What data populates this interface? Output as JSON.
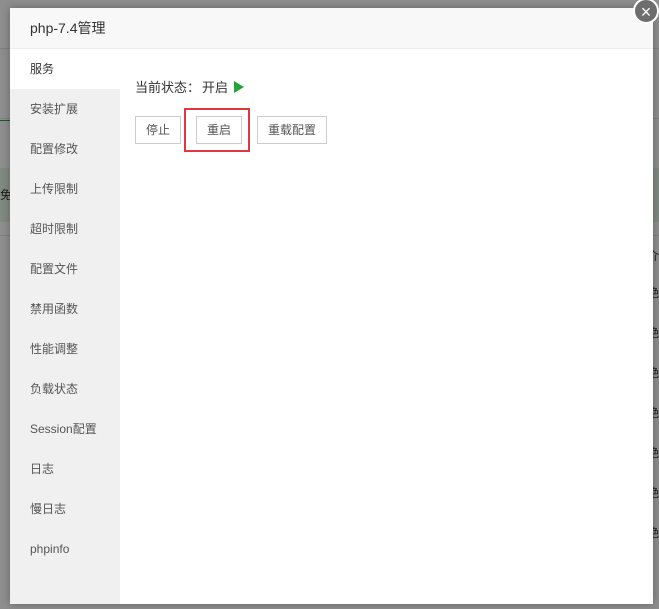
{
  "dialog": {
    "title": "php-7.4管理",
    "close_icon": "×"
  },
  "sidebar": {
    "items": [
      {
        "label": "服务"
      },
      {
        "label": "安装扩展"
      },
      {
        "label": "配置修改"
      },
      {
        "label": "上传限制"
      },
      {
        "label": "超时限制"
      },
      {
        "label": "配置文件"
      },
      {
        "label": "禁用函数"
      },
      {
        "label": "性能调整"
      },
      {
        "label": "负载状态"
      },
      {
        "label": "Session配置"
      },
      {
        "label": "日志"
      },
      {
        "label": "慢日志"
      },
      {
        "label": "phpinfo"
      }
    ]
  },
  "service": {
    "status_label": "当前状态：",
    "status_value": "开启",
    "status_icon": "play-icon",
    "status_color": "#20a53a",
    "buttons": {
      "stop": "停止",
      "restart": "重启",
      "reload": "重载配置"
    }
  },
  "background": {
    "left_char": "免",
    "right_header": "介",
    "right_cells": [
      "绝",
      "绝",
      "绝",
      "绝",
      "绝",
      "绝",
      "绝"
    ]
  },
  "colors": {
    "highlight": "#e0373a",
    "accent_green": "#20a53a"
  }
}
